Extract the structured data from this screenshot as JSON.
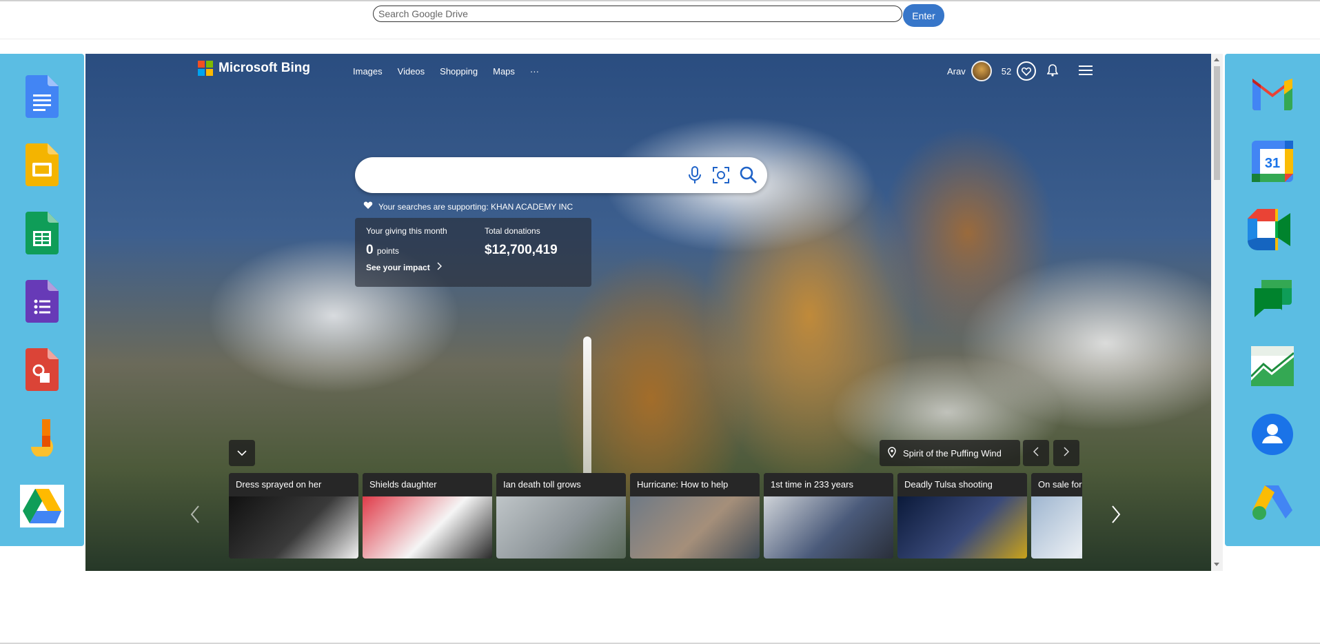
{
  "drive": {
    "search_placeholder": "Search Google Drive",
    "enter_label": "Enter"
  },
  "left_apps": [
    "google-docs-icon",
    "google-slides-icon",
    "google-sheets-icon",
    "google-forms-icon",
    "google-drawings-icon",
    "google-jamboard-icon",
    "google-drive-icon"
  ],
  "right_apps": [
    "gmail-icon",
    "google-calendar-icon",
    "google-meet-icon",
    "google-chat-icon",
    "google-sheets-chart-icon",
    "google-contacts-icon",
    "google-ads-icon"
  ],
  "calendar_day": "31",
  "bing": {
    "brand": "Microsoft Bing",
    "nav": [
      "Images",
      "Videos",
      "Shopping",
      "Maps",
      "···"
    ],
    "user_name": "Arav",
    "points": "52",
    "supporting_text": "Your searches are supporting: KHAN ACADEMY INC",
    "giving": {
      "month_label": "Your giving this month",
      "month_value": "0",
      "points_label": "points",
      "total_label": "Total donations",
      "total_value": "$12,700,419",
      "impact_link": "See your impact"
    },
    "location": "Spirit of the Puffing Wind",
    "cards": [
      {
        "title": "Dress sprayed on her",
        "colors": [
          "#111",
          "#3a3a3a",
          "#f2f2f2"
        ]
      },
      {
        "title": "Shields daughter",
        "colors": [
          "#e03c4a",
          "#f5f5f5",
          "#2a2a2a"
        ]
      },
      {
        "title": "Ian death toll grows",
        "colors": [
          "#bfc5c8",
          "#8d9599",
          "#5a6a5a"
        ]
      },
      {
        "title": "Hurricane: How to help",
        "colors": [
          "#6f7a86",
          "#a58f7a",
          "#3e4a55"
        ]
      },
      {
        "title": "1st time in 233 years",
        "colors": [
          "#cfd3d8",
          "#4a5a7a",
          "#2a2f3a"
        ]
      },
      {
        "title": "Deadly Tulsa shooting",
        "colors": [
          "#0b1a3a",
          "#3a4a7a",
          "#c9a21a"
        ]
      },
      {
        "title": "On sale for",
        "colors": [
          "#9fb6d0",
          "#e8edf2",
          "#6d8aa8"
        ]
      }
    ]
  }
}
